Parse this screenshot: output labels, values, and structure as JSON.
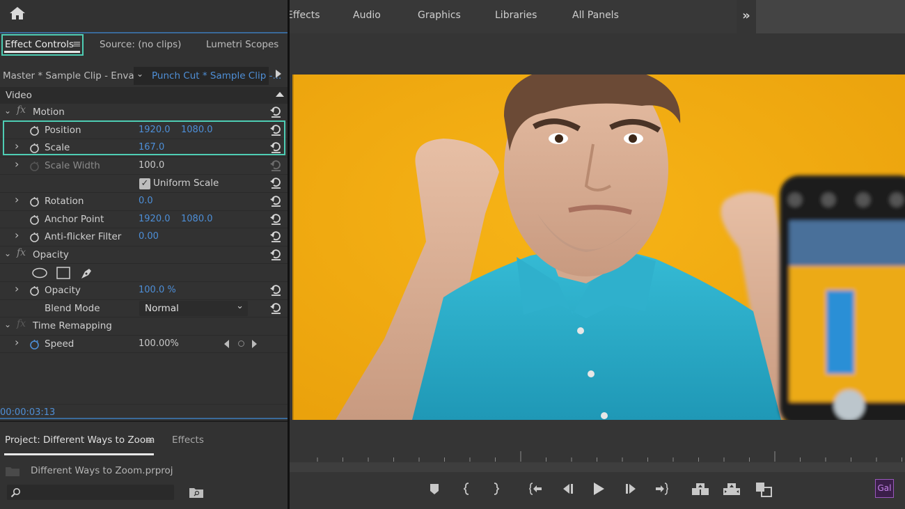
{
  "workspace_tabs": [
    "Effects",
    "Audio",
    "Graphics",
    "Libraries",
    "All Panels"
  ],
  "workspace_more_icon": "double-chevron-right-icon",
  "home_icon": "home-icon",
  "effect_controls": {
    "tabs": [
      "Effect Controls",
      "Source: (no clips)",
      "Lumetri Scopes"
    ],
    "active_tab": "Effect Controls",
    "master_clip": "Master * Sample Clip - Envat...",
    "sequence_clip": "Punch Cut * Sample Clip -...",
    "section_label": "Video",
    "effects": [
      {
        "name": "Motion",
        "properties": [
          {
            "label": "Position",
            "values": [
              "1920.0",
              "1080.0"
            ],
            "highlighted": true
          },
          {
            "label": "Scale",
            "values": [
              "167.0"
            ],
            "highlighted": true,
            "expandable": true
          },
          {
            "label": "Scale Width",
            "values": [
              "100.0"
            ],
            "disabled": true,
            "expandable": true
          },
          {
            "label": "Uniform Scale",
            "checkbox": true,
            "checked": true
          },
          {
            "label": "Rotation",
            "values": [
              "0.0"
            ],
            "expandable": true
          },
          {
            "label": "Anchor Point",
            "values": [
              "1920.0",
              "1080.0"
            ]
          },
          {
            "label": "Anti-flicker Filter",
            "values": [
              "0.00"
            ],
            "expandable": true
          }
        ]
      },
      {
        "name": "Opacity",
        "mask_tools": [
          "ellipse-mask-icon",
          "rectangle-mask-icon",
          "pen-mask-icon"
        ],
        "properties": [
          {
            "label": "Opacity",
            "values": [
              "100.0 %"
            ],
            "expandable": true
          },
          {
            "label": "Blend Mode",
            "dropdown": "Normal"
          }
        ]
      },
      {
        "name": "Time Remapping",
        "properties": [
          {
            "label": "Speed",
            "values": [
              "100.00%"
            ],
            "expandable": true,
            "keyframe_nav": true
          }
        ]
      }
    ],
    "timecode": "00:00:03:13"
  },
  "project": {
    "tab": "Project: Different Ways to Zoom",
    "other_tab": "Effects",
    "file": "Different Ways to Zoom.prproj",
    "search_placeholder": ""
  },
  "monitor": {
    "controls": [
      "add-marker",
      "mark-in",
      "mark-out",
      "go-to-in",
      "step-back",
      "play",
      "step-forward",
      "go-to-out",
      "insert",
      "overwrite",
      "export-frame"
    ],
    "gal_button": "Gal"
  },
  "colors": {
    "accent_highlight": "#4ecdb4",
    "value_blue": "#4d8fd8",
    "panel_bg": "#323232",
    "video_bg": "#f1aa0f",
    "shirt": "#2fb0cc"
  }
}
